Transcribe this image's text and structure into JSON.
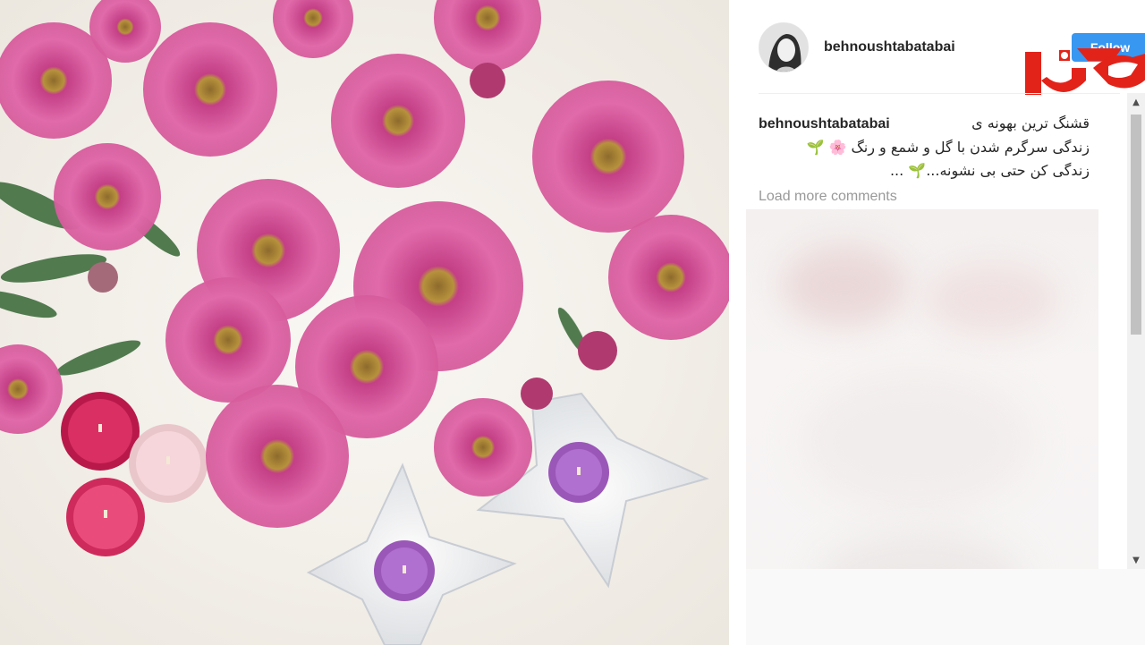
{
  "post": {
    "username": "behnoushtabatabai",
    "follow_label": "Follow"
  },
  "caption": {
    "username": "behnoushtabatabai",
    "line1": "قشنگ ترین بهونه ی",
    "line2": "زندگی سرگرم شدن با گل و شمع و رنگ 🌸 🌱",
    "line3": "زندگی کن حتی بی نشونه...🌱 ..."
  },
  "comments": {
    "load_more_label": "Load more comments"
  },
  "icons": {
    "avatar": "profile-avatar",
    "logo": "rokna-logo",
    "scroll_up": "chevron-up-icon",
    "scroll_down": "chevron-down-icon"
  },
  "colors": {
    "follow_bg": "#3897f0",
    "logo_red": "#e2231a",
    "text": "#262626",
    "muted": "#999999"
  }
}
